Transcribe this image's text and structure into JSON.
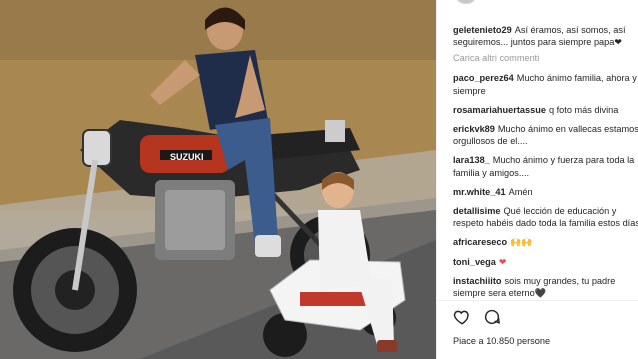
{
  "comments": [
    {
      "user": "geletenieto29",
      "text": "Así éramos, así somos, así seguiremos... juntos para siempre papa❤"
    },
    {
      "user": "paco_perez64",
      "text": "Mucho ánimo familia, ahora y siempre"
    },
    {
      "user": "rosamariahuertassue",
      "text": "q foto más divina"
    },
    {
      "user": "erickvk89",
      "text": "Mucho ánimo en vallecas estamos orgullosos de el...."
    },
    {
      "user": "lara138_",
      "text": "Mucho ánimo y fuerza para toda la familia y amigos...."
    },
    {
      "user": "mr.white_41",
      "text": "Amén"
    },
    {
      "user": "detallisime",
      "text": "Qué lección de educación y respeto habéis dado toda la familia estos días!"
    },
    {
      "user": "africareseco",
      "text": "🙌🙌"
    },
    {
      "user": "toni_vega",
      "text": "❤"
    },
    {
      "user": "instachiiito",
      "text": "sois muy grandes, tu padre siempre sera eterno🖤"
    }
  ],
  "load_more": "Carica altri commenti",
  "likes_text": "Piace a 10.850 persone",
  "photo": {
    "motorcycle_brand": "SUZUKI"
  },
  "icons": {
    "like": "heart-icon",
    "comment": "comment-icon"
  },
  "colors": {
    "username": "#262626",
    "muted": "#999999",
    "accent_heart": "#ed4956"
  }
}
